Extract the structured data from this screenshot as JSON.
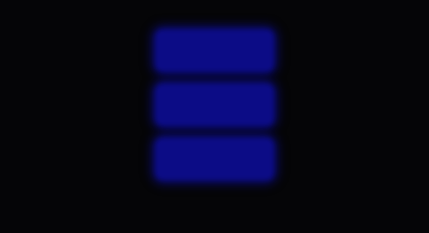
{
  "menu": {
    "buttons": [
      {
        "label": ""
      },
      {
        "label": ""
      },
      {
        "label": ""
      }
    ]
  },
  "colors": {
    "background": "#050507",
    "button_fill": "#0c0c86",
    "button_glow": "#0a0a70",
    "button_text": "#2e2ec0"
  }
}
